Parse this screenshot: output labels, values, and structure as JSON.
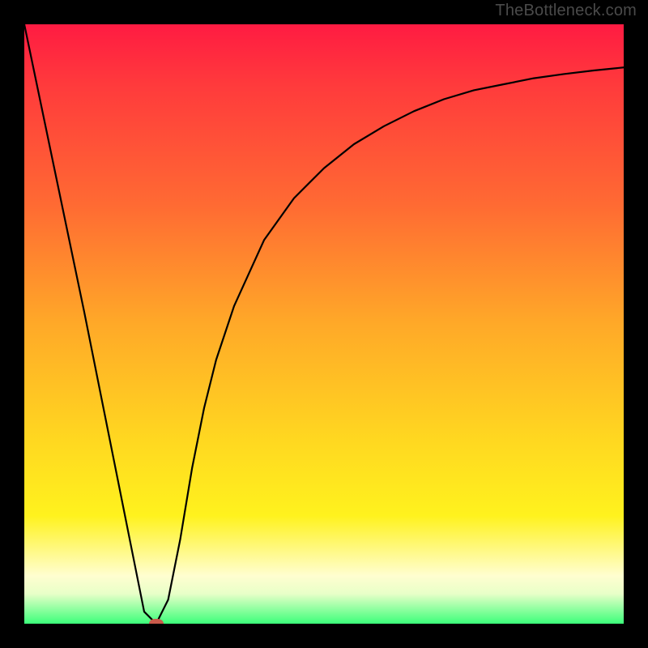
{
  "watermark": "TheBottleneck.com",
  "gradient": {
    "top": "#ff1b42",
    "mid1": "#ff6a33",
    "mid2": "#ffa928",
    "mid3": "#ffd920",
    "mid4": "#fff21e",
    "bottom": "#3cff7a"
  },
  "chart_data": {
    "type": "line",
    "title": "",
    "xlabel": "",
    "ylabel": "",
    "xlim": [
      0,
      100
    ],
    "ylim": [
      0,
      100
    ],
    "grid": false,
    "legend": false,
    "series": [
      {
        "name": "bottleneck-curve",
        "x": [
          0,
          5,
          10,
          15,
          18,
          20,
          22,
          24,
          26,
          28,
          30,
          32,
          35,
          40,
          45,
          50,
          55,
          60,
          65,
          70,
          75,
          80,
          85,
          90,
          95,
          100
        ],
        "y": [
          100,
          76,
          52,
          27,
          12,
          2,
          0,
          4,
          14,
          26,
          36,
          44,
          53,
          64,
          71,
          76,
          80,
          83,
          85.5,
          87.5,
          89,
          90,
          91,
          91.7,
          92.3,
          92.8
        ]
      }
    ],
    "marker": {
      "x": 22,
      "y": 0,
      "color": "#c95a4a"
    }
  }
}
